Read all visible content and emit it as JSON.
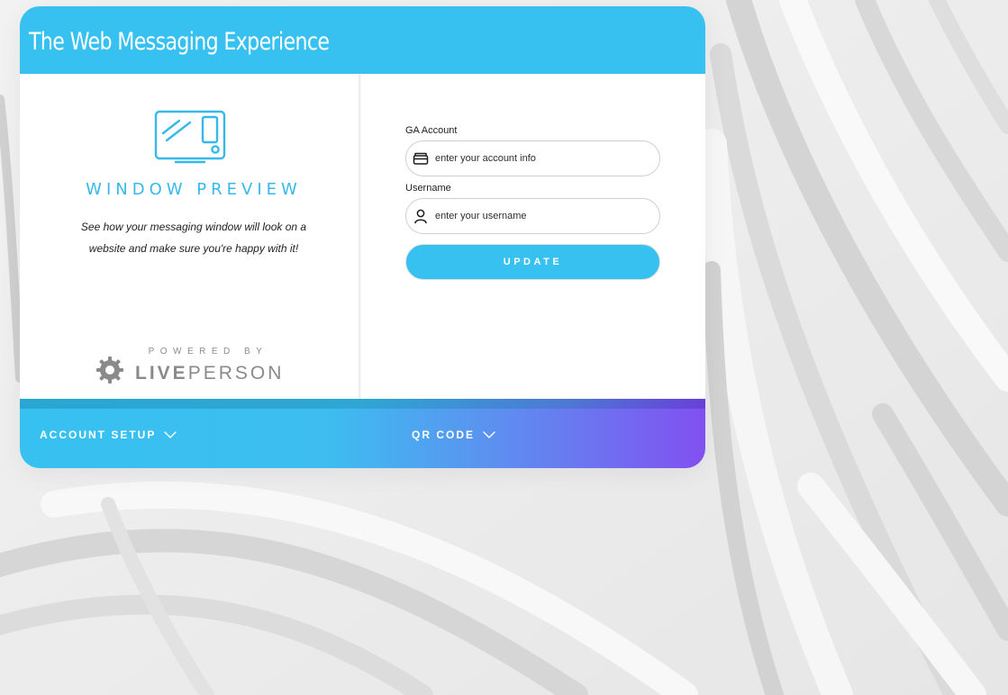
{
  "header": {
    "title": "The Web Messaging Experience"
  },
  "preview": {
    "icon": "monitor-phone-icon",
    "title": "WINDOW PREVIEW",
    "description_line1": "See how your messaging window will look on a",
    "description_line2": "website and make sure you're happy with it!"
  },
  "branding": {
    "powered_by": "POWERED BY",
    "logo_text_strong": "LIVE",
    "logo_text_light": "PERSON",
    "logo_icon": "liveperson-gear-icon"
  },
  "form": {
    "ga_account": {
      "label": "GA Account",
      "placeholder": "enter your account info",
      "value": "",
      "icon": "wallet-icon"
    },
    "username": {
      "label": "Username",
      "placeholder": "enter your username",
      "value": "",
      "icon": "user-icon"
    },
    "submit_label": "UPDATE"
  },
  "footer": {
    "items": [
      {
        "label": "ACCOUNT SETUP",
        "icon": "chevron-down-icon"
      },
      {
        "label": "QR CODE",
        "icon": "chevron-down-icon"
      }
    ]
  },
  "colors": {
    "accent": "#36c1f0",
    "gradient_end": "#8150f0",
    "background": "#ececec"
  }
}
